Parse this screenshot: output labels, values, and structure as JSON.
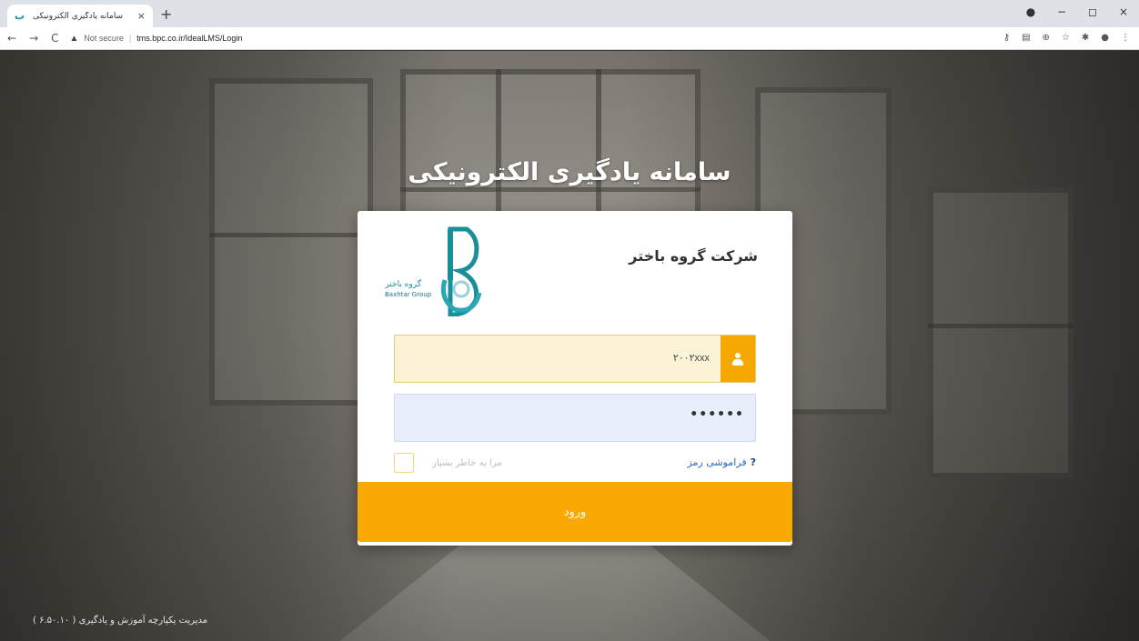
{
  "browser": {
    "tab_title": "سامانه یادگیری الکترونیکی",
    "tab_favicon": "ب",
    "tab_close": "×",
    "new_tab": "+",
    "security_label": "Not secure",
    "url": "tms.bpc.co.ir/IdealLMS/Login",
    "window_controls": [
      "●",
      "−",
      "◻",
      "×"
    ]
  },
  "page": {
    "title": "سامانه یادگیری الکترونیکی",
    "company_name": "شرکت گروه باختر",
    "logo": {
      "text_fa": "گروه باختر",
      "text_en": "Baxhtar Group",
      "icon": "baxhtar-logo",
      "color": "#1a8f9a"
    },
    "username_value": "۲۰۰۲xxx",
    "password_value": "••••••",
    "forgot_password": "فراموشی رمز",
    "forgot_icon": "?",
    "remember_me": "مرا به خاطر بسپار",
    "login_button": "ورود",
    "footer": "مدیریت یکپارچه آموزش و یادگیری ( ۶.۵۰.۱۰ )",
    "accent_color": "#f9a900"
  }
}
